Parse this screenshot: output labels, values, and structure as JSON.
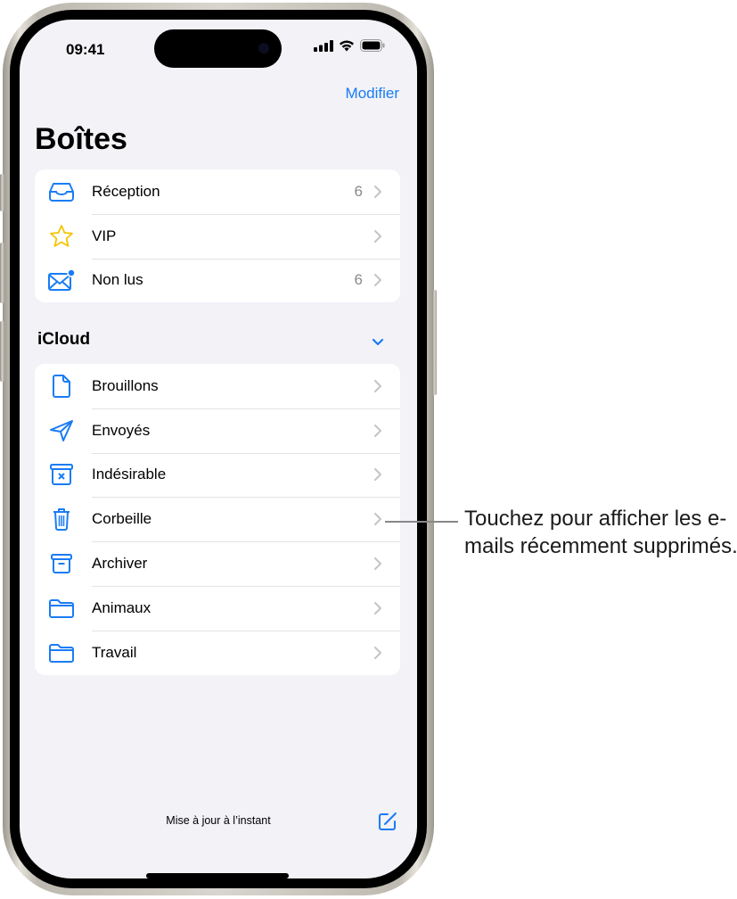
{
  "status_bar": {
    "time": "09:41",
    "icons": [
      "cellular-signal-icon",
      "wifi-icon",
      "battery-icon"
    ]
  },
  "nav": {
    "edit_label": "Modifier"
  },
  "page_title": "Boîtes",
  "colors": {
    "accent": "#1a7cf5",
    "vip_star": "#f5c400",
    "background": "#f2f2f7"
  },
  "smart_mailboxes": [
    {
      "label": "Réception",
      "count": "6",
      "icon": "inbox-icon"
    },
    {
      "label": "VIP",
      "count": "",
      "icon": "star-icon"
    },
    {
      "label": "Non lus",
      "count": "6",
      "icon": "unread-envelope-icon"
    }
  ],
  "icloud": {
    "title": "iCloud",
    "collapse_icon": "chevron-down-icon",
    "items": [
      {
        "label": "Brouillons",
        "icon": "draft-document-icon"
      },
      {
        "label": "Envoyés",
        "icon": "paper-plane-icon"
      },
      {
        "label": "Indésirable",
        "icon": "junk-bin-icon"
      },
      {
        "label": "Corbeille",
        "icon": "trash-icon"
      },
      {
        "label": "Archiver",
        "icon": "archive-box-icon"
      },
      {
        "label": "Animaux",
        "icon": "folder-icon"
      },
      {
        "label": "Travail",
        "icon": "folder-icon"
      }
    ]
  },
  "footer": {
    "status": "Mise à jour à l’instant",
    "compose_icon": "compose-icon"
  },
  "callout": {
    "text": "Touchez pour afficher les e-mails récemment supprimés.",
    "target": "Corbeille"
  }
}
